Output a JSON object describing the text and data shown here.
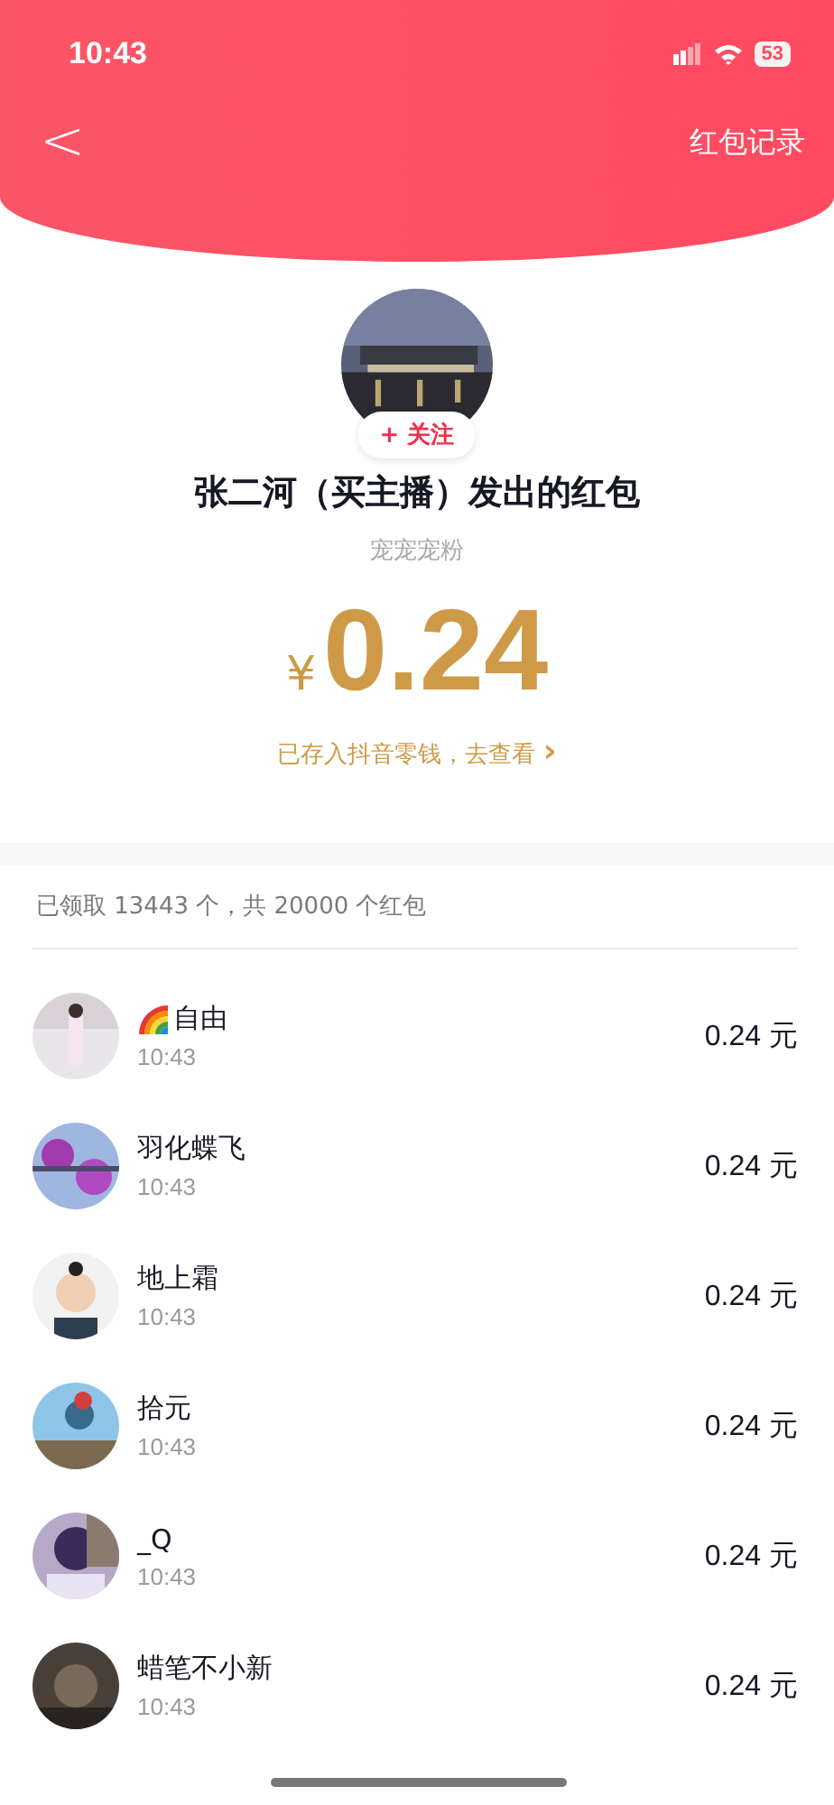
{
  "status_bar": {
    "time": "10:43",
    "battery": "53"
  },
  "nav": {
    "back": "<",
    "title": "红包记录"
  },
  "sender": {
    "follow": "+ 关注",
    "title": "张二河（买主播）发出的红包",
    "subtitle": "宠宠宠粉",
    "currency": "¥",
    "amount": "0.24",
    "link": "已存入抖音零钱，去查看",
    "link_arrow": "›"
  },
  "summary": "已领取 13443 个，共 20000 个红包",
  "recipients": [
    {
      "kind": "rainbow",
      "name": "自由",
      "time": "10:43",
      "amount": "0.24 元"
    },
    {
      "kind": "plain",
      "name": "羽化蝶飞",
      "time": "10:43",
      "amount": "0.24 元"
    },
    {
      "kind": "plain",
      "name": "地上霜",
      "time": "10:43",
      "amount": "0.24 元"
    },
    {
      "kind": "plain",
      "name": "拾元",
      "time": "10:43",
      "amount": "0.24 元"
    },
    {
      "kind": "plain",
      "name": "_Q",
      "time": "10:43",
      "amount": "0.24 元"
    },
    {
      "kind": "plain",
      "name": "蜡笔不小新",
      "time": "10:43",
      "amount": "0.24 元"
    }
  ]
}
